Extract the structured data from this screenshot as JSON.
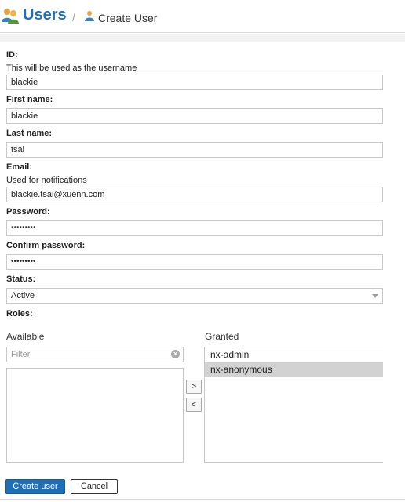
{
  "header": {
    "title": "Users",
    "separator": "/",
    "subtitle": "Create User"
  },
  "form": {
    "id": {
      "label": "ID:",
      "help": "This will be used as the username",
      "value": "blackie"
    },
    "first_name": {
      "label": "First name:",
      "value": "blackie"
    },
    "last_name": {
      "label": "Last name:",
      "value": "tsai"
    },
    "email": {
      "label": "Email:",
      "help": "Used for notifications",
      "value": "blackie.tsai@xuenn.com"
    },
    "password": {
      "label": "Password:",
      "value": "•••••••••"
    },
    "confirm_password": {
      "label": "Confirm password:",
      "value": "•••••••••"
    },
    "status": {
      "label": "Status:",
      "value": "Active"
    },
    "roles": {
      "label": "Roles:",
      "available_title": "Available",
      "filter_placeholder": "Filter",
      "granted_title": "Granted",
      "move_right": ">",
      "move_left": "<",
      "granted": [
        {
          "name": "nx-admin",
          "selected": false
        },
        {
          "name": "nx-anonymous",
          "selected": true
        }
      ]
    }
  },
  "actions": {
    "create_label": "Create user",
    "cancel_label": "Cancel"
  },
  "colors": {
    "accent": "#1f6fb8",
    "selected_row": "#d2d2d2"
  },
  "icons": {
    "header": "users-icon",
    "breadcrumb": "user-icon",
    "filter_clear": "clear-icon",
    "status_dropdown": "chevron-down-icon"
  }
}
